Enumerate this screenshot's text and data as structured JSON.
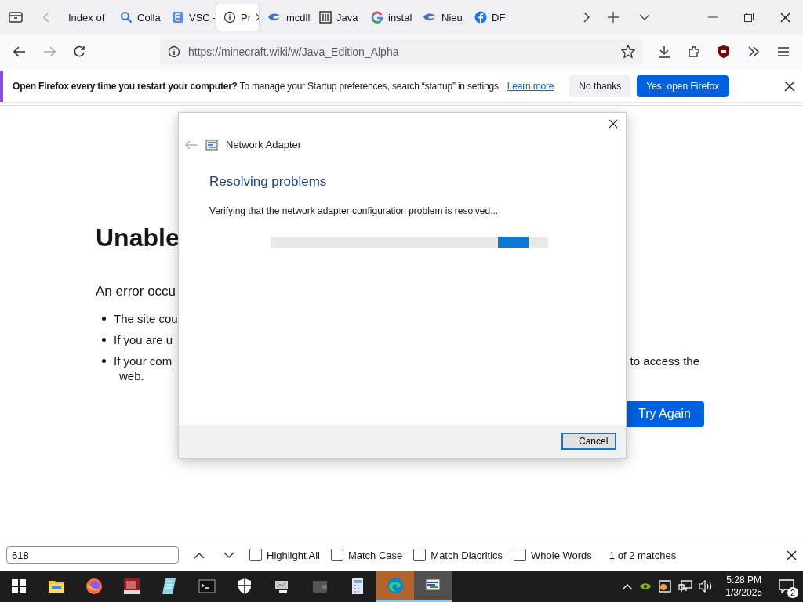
{
  "tabs": [
    {
      "kind": "page",
      "title": "Index of",
      "selected": false
    },
    {
      "kind": "search",
      "title": "Colla",
      "selected": false
    },
    {
      "kind": "letter-e",
      "title": "VSC -",
      "selected": false
    },
    {
      "kind": "info",
      "title": "Pr",
      "selected": true
    },
    {
      "kind": "swirl",
      "title": "mcdll",
      "selected": false
    },
    {
      "kind": "pillars",
      "title": "Java",
      "selected": false
    },
    {
      "kind": "g",
      "title": "instal",
      "selected": false
    },
    {
      "kind": "swirl",
      "title": "Nieu",
      "selected": false
    },
    {
      "kind": "facebook",
      "title": "DF",
      "selected": false
    }
  ],
  "address": {
    "url_host": "https://minecraft.wiki",
    "url_path": "/w/Java_Edition_Alpha"
  },
  "notification": {
    "text": "**Open Firefox every time you restart your computer?** To manage your Startup preferences, search “startup” in settings.",
    "link": "Learn more",
    "buttons": [
      {
        "label": "No thanks",
        "kind": "secondary"
      },
      {
        "label": "Yes, open Firefox",
        "kind": "primary"
      }
    ]
  },
  "error_page": {
    "title": "Unable",
    "intro": "An error occu",
    "bullets": [
      {
        "text": "The site cou"
      },
      {
        "text": "If you are u"
      },
      {
        "text": "If your com",
        "text_right": "to access the",
        "continuation": "web."
      }
    ],
    "button": "Try Again"
  },
  "dialog": {
    "title": "Network Adapter",
    "heading": "Resolving problems",
    "message": "Verifying that the network adapter configuration problem is resolved...",
    "button": "Cancel"
  },
  "find_bar": {
    "value": "618",
    "options": [
      {
        "label": "Highlight All",
        "checked": false
      },
      {
        "label": "Match Case",
        "checked": false
      },
      {
        "label": "Match Diacritics",
        "checked": false
      },
      {
        "label": "Whole Words",
        "checked": false
      }
    ],
    "result": "1 of 2 matches"
  },
  "taskbar": {
    "apps": [
      {
        "kind": "folder",
        "selected": false
      },
      {
        "kind": "firefox",
        "selected": false
      },
      {
        "kind": "book",
        "selected": false
      },
      {
        "kind": "notepad",
        "selected": false
      },
      {
        "kind": "terminal",
        "selected": false
      },
      {
        "kind": "shield",
        "selected": false
      },
      {
        "kind": "monitor",
        "selected": false
      },
      {
        "kind": "wallet",
        "selected": false
      },
      {
        "kind": "calculator",
        "selected": false
      },
      {
        "kind": "edge",
        "selected": true
      },
      {
        "kind": "network",
        "selected": true
      }
    ],
    "time": "5:28 PM",
    "date": "1/3/2025",
    "notifications": "2"
  }
}
